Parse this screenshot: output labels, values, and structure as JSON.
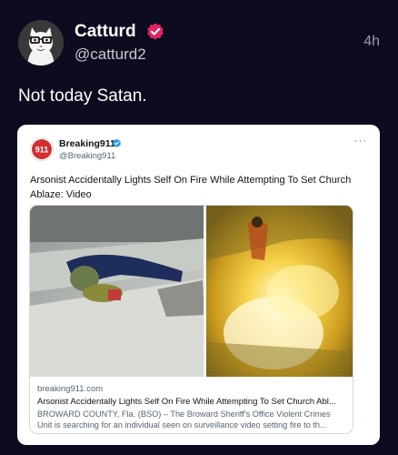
{
  "post": {
    "author_name": "Catturd",
    "handle": "@catturd2",
    "timestamp": "4h",
    "text": "Not today Satan.",
    "verified_color": "#e0245e"
  },
  "quote": {
    "author_name": "Breaking911",
    "handle": "@Breaking911",
    "more": "···",
    "text": "Arsonist Accidentally Lights Self On Fire While Attempting To Set Church Ablaze: Video",
    "avatar_text": "911",
    "verified_color": "#1d9bf0",
    "link": {
      "domain": "breaking911.com",
      "title": "Arsonist Accidentally Lights Self On Fire While Attempting To Set Church Abl...",
      "description": "BROWARD COUNTY, Fla. (BSO) – The Broward Sheriff's Office Violent Crimes Unit is searching for an individual seen on surveillance video setting fire to th..."
    }
  }
}
